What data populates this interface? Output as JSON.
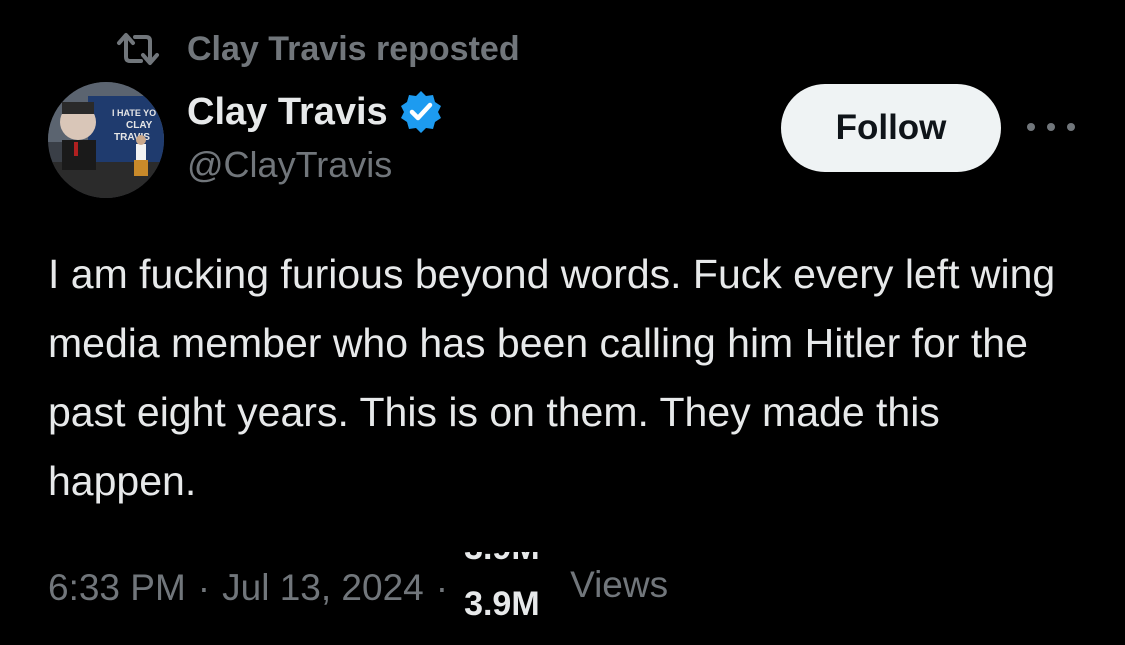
{
  "repost": {
    "icon": "repost-icon",
    "text": "Clay Travis reposted"
  },
  "author": {
    "display_name": "Clay Travis",
    "handle": "@ClayTravis",
    "verified_icon": "verified-badge-icon",
    "avatar_sign_text": "I HATE YOU CLAY TRAVIS"
  },
  "actions": {
    "follow_label": "Follow",
    "more_icon": "more-options-icon"
  },
  "tweet": {
    "text": "I am fucking furious beyond words. Fuck every left wing media member who has been calling him Hitler for the past eight years. This is on them. They made this happen."
  },
  "meta": {
    "time": "6:33 PM",
    "separator": "·",
    "date": "Jul 13, 2024",
    "views_count": "3.9M",
    "views_label": "Views"
  },
  "colors": {
    "background": "#000000",
    "primary_text": "#e7e9ea",
    "secondary_text": "#71767b",
    "verified_blue": "#1d9bf0",
    "follow_bg": "#eff3f4",
    "follow_text": "#0f1419"
  }
}
